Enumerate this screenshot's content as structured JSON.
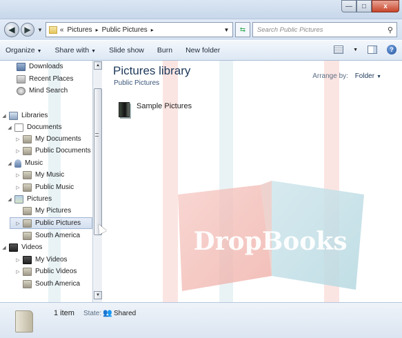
{
  "window": {
    "min_symbol": "—",
    "max_symbol": "□",
    "close_symbol": "x"
  },
  "address": {
    "prefix": "«",
    "seg1": "Pictures",
    "seg2": "Public Pictures",
    "arrow": "▸",
    "search_placeholder": "Search Public Pictures"
  },
  "toolbar": {
    "organize": "Organize",
    "share": "Share with",
    "slideshow": "Slide show",
    "burn": "Burn",
    "newfolder": "New folder"
  },
  "nav": {
    "items": [
      {
        "label": "Downloads"
      },
      {
        "label": "Recent Places"
      },
      {
        "label": "Mind Search"
      },
      {
        "label": "Libraries"
      },
      {
        "label": "Documents"
      },
      {
        "label": "My Documents"
      },
      {
        "label": "Public Documents"
      },
      {
        "label": "Music"
      },
      {
        "label": "My Music"
      },
      {
        "label": "Public Music"
      },
      {
        "label": "Pictures"
      },
      {
        "label": "My Pictures"
      },
      {
        "label": "Public Pictures"
      },
      {
        "label": "South America"
      },
      {
        "label": "Videos"
      },
      {
        "label": "My Videos"
      },
      {
        "label": "Public Videos"
      },
      {
        "label": "South America"
      }
    ]
  },
  "main": {
    "title": "Pictures library",
    "subtitle": "Public Pictures",
    "arrange_label": "Arrange by:",
    "arrange_value": "Folder",
    "files": [
      {
        "name": "Sample Pictures"
      }
    ]
  },
  "status": {
    "count": "1 item",
    "state_label": "State:",
    "state_value": "Shared"
  },
  "watermark_text": "DropBooks"
}
